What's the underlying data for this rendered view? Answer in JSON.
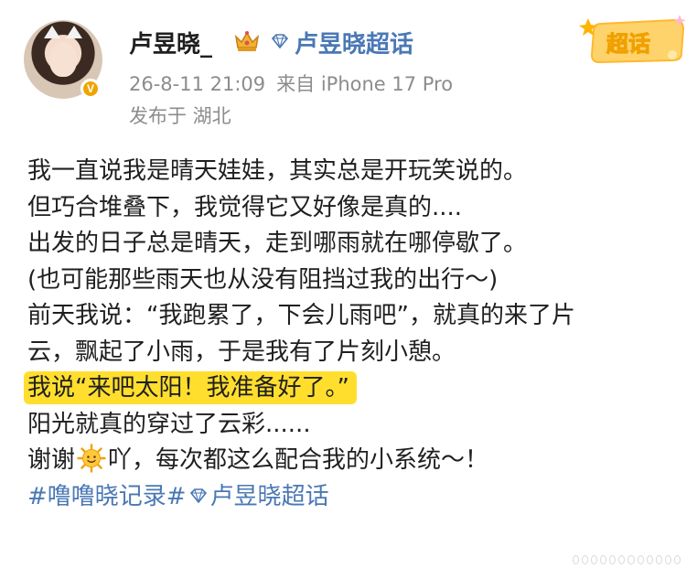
{
  "post": {
    "username": "卢昱晓_",
    "topic_label": "卢昱晓超话",
    "time": "26-8-11 21:09",
    "source": "来自 iPhone 17 Pro",
    "location": "发布于 湖北",
    "sticker_label": "超话",
    "lines": [
      "我一直说我是晴天娃娃，其实总是开玩笑说的。",
      "但巧合堆叠下，我觉得它又好像是真的....",
      "出发的日子总是晴天，走到哪雨就在哪停歇了。",
      "(也可能那些雨天也从没有阻挡过我的出行～)",
      "前天我说：“我跑累了，下会儿雨吧”，就真的来了片",
      "云，飘起了小雨，于是我有了片刻小憩。"
    ],
    "highlight_line": "我说“来吧太阳！我准备好了。”",
    "line_after_highlight": "阳光就真的穿过了云彩......",
    "thanks_before": "谢谢",
    "thanks_after": "吖，每次都这么配合我的小系统～！",
    "tag1": "#噜噜晓记录#",
    "tag2": "卢昱晓超话"
  },
  "icons": {
    "crown": "crown-badge-icon",
    "diamond": "super-topic-diamond-icon",
    "sun": "sun-emoji-icon",
    "verified": "verified-v-icon"
  },
  "colors": {
    "link": "#4a78b5",
    "highlight": "#ffde2e",
    "meta": "#8c8c8c",
    "verified": "#f0a400"
  }
}
